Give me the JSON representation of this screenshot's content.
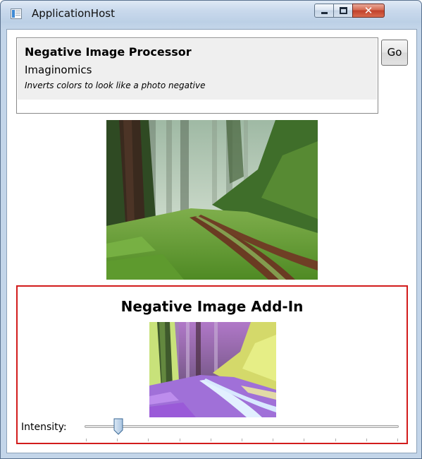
{
  "window": {
    "title": "ApplicationHost",
    "controls": {
      "minimize_icon": "minimize-icon",
      "maximize_icon": "maximize-icon",
      "close_glyph": "✕"
    }
  },
  "processor_info": {
    "name": "Negative Image Processor",
    "vendor": "Imaginomics",
    "description": "Inverts colors to look like a photo negative"
  },
  "go_button": {
    "label": "Go"
  },
  "addin": {
    "title": "Negative Image Add-In",
    "intensity_label": "Intensity:",
    "intensity_fraction": 0.1,
    "tick_count": 11
  },
  "colors": {
    "addin_border": "#d21c1c",
    "titlebar": "#c9d9ec"
  }
}
